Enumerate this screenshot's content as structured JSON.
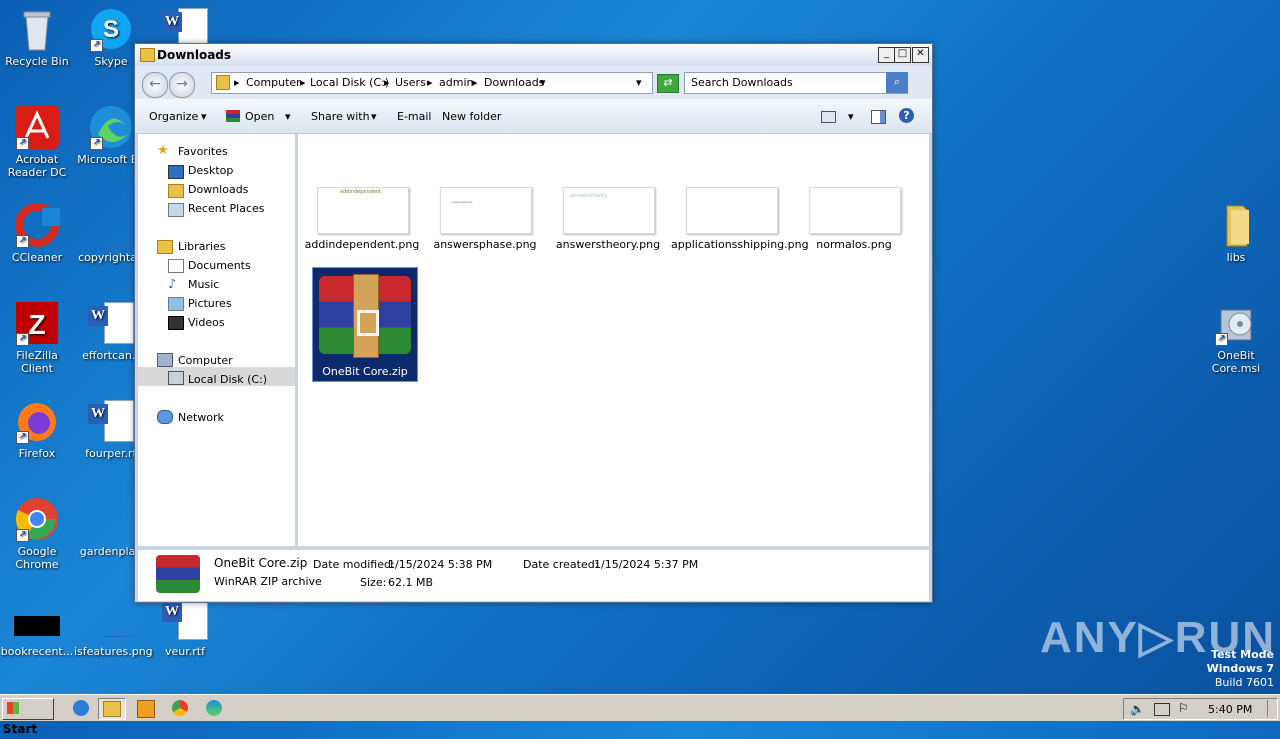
{
  "desktop": {
    "icons": [
      {
        "label": "Recycle Bin"
      },
      {
        "label": "Skype"
      },
      {
        "label": "Acrobat Reader DC"
      },
      {
        "label": "Microsoft Ed"
      },
      {
        "label": "CCleaner"
      },
      {
        "label": "copyrightap"
      },
      {
        "label": "FileZilla Client"
      },
      {
        "label": "effortcan.r"
      },
      {
        "label": "Firefox"
      },
      {
        "label": "fourper.rt"
      },
      {
        "label": "Google Chrome"
      },
      {
        "label": "gardenplan"
      },
      {
        "label": "bookrecent..."
      },
      {
        "label": "isfeatures.png"
      },
      {
        "label": "veur.rtf"
      },
      {
        "label": "libs"
      },
      {
        "label": "OneBit Core.msi"
      }
    ]
  },
  "window": {
    "title": "Downloads",
    "min_label": "_",
    "max_label": "□",
    "close_label": "✕",
    "breadcrumb": [
      "Computer",
      "Local Disk (C:)",
      "Users",
      "admin",
      "Downloads"
    ],
    "search_placeholder": "Search Downloads",
    "toolbar": {
      "organize": "Organize",
      "open": "Open",
      "share": "Share with",
      "email": "E-mail",
      "new_folder": "New folder"
    },
    "nav": {
      "favorites": "Favorites",
      "desktop": "Desktop",
      "downloads": "Downloads",
      "recent": "Recent Places",
      "libraries": "Libraries",
      "documents": "Documents",
      "music": "Music",
      "pictures": "Pictures",
      "videos": "Videos",
      "computer": "Computer",
      "local_disk": "Local Disk (C:)",
      "network": "Network"
    },
    "files": [
      {
        "name": "addindependent.png",
        "thumb_text": "addindependent"
      },
      {
        "name": "answersphase.png",
        "thumb_text": "answersphase"
      },
      {
        "name": "answerstheory.png",
        "thumb_text": "answerstheory"
      },
      {
        "name": "applicationsshipping.png",
        "thumb_text": ""
      },
      {
        "name": "normalos.png",
        "thumb_text": ""
      },
      {
        "name": "OneBit Core.zip",
        "thumb_text": ""
      }
    ],
    "details": {
      "name": "OneBit Core.zip",
      "type": "WinRAR ZIP archive",
      "modified_label": "Date modified:",
      "modified": "1/15/2024 5:38 PM",
      "created_label": "Date created:",
      "created": "1/15/2024 5:37 PM",
      "size_label": "Size:",
      "size": "62.1 MB"
    }
  },
  "taskbar": {
    "start": "Start",
    "clock": "5:40 PM"
  },
  "watermark": {
    "text": "ANY▷RUN"
  },
  "test_mode": {
    "line1": "Test Mode",
    "line2": "Windows 7",
    "line3": "Build 7601"
  }
}
